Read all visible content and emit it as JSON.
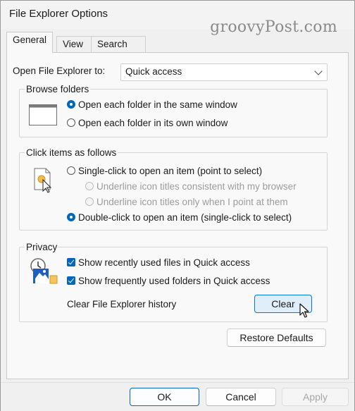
{
  "window": {
    "title": "File Explorer Options",
    "watermark": "groovyPost.com",
    "close_glyph": "✕"
  },
  "tabs": [
    {
      "label": "General",
      "active": true
    },
    {
      "label": "View",
      "active": false
    },
    {
      "label": "Search",
      "active": false
    }
  ],
  "open_row": {
    "label": "Open File Explorer to:",
    "value": "Quick access"
  },
  "browse": {
    "legend": "Browse folders",
    "options": [
      {
        "label": "Open each folder in the same window",
        "selected": true
      },
      {
        "label": "Open each folder in its own window",
        "selected": false
      }
    ]
  },
  "click": {
    "legend": "Click items as follows",
    "single": "Single-click to open an item (point to select)",
    "sub1": "Underline icon titles consistent with my browser",
    "sub2": "Underline icon titles only when I point at them",
    "double": "Double-click to open an item (single-click to select)"
  },
  "privacy": {
    "legend": "Privacy",
    "check1": "Show recently used files in Quick access",
    "check2": "Show frequently used folders in Quick access",
    "clear_label": "Clear File Explorer history",
    "clear_button": "Clear"
  },
  "restore_button": "Restore Defaults",
  "footer": {
    "ok": "OK",
    "cancel": "Cancel",
    "apply": "Apply"
  },
  "colors": {
    "accent": "#0067c0",
    "hover_bg": "#e0eef9"
  }
}
